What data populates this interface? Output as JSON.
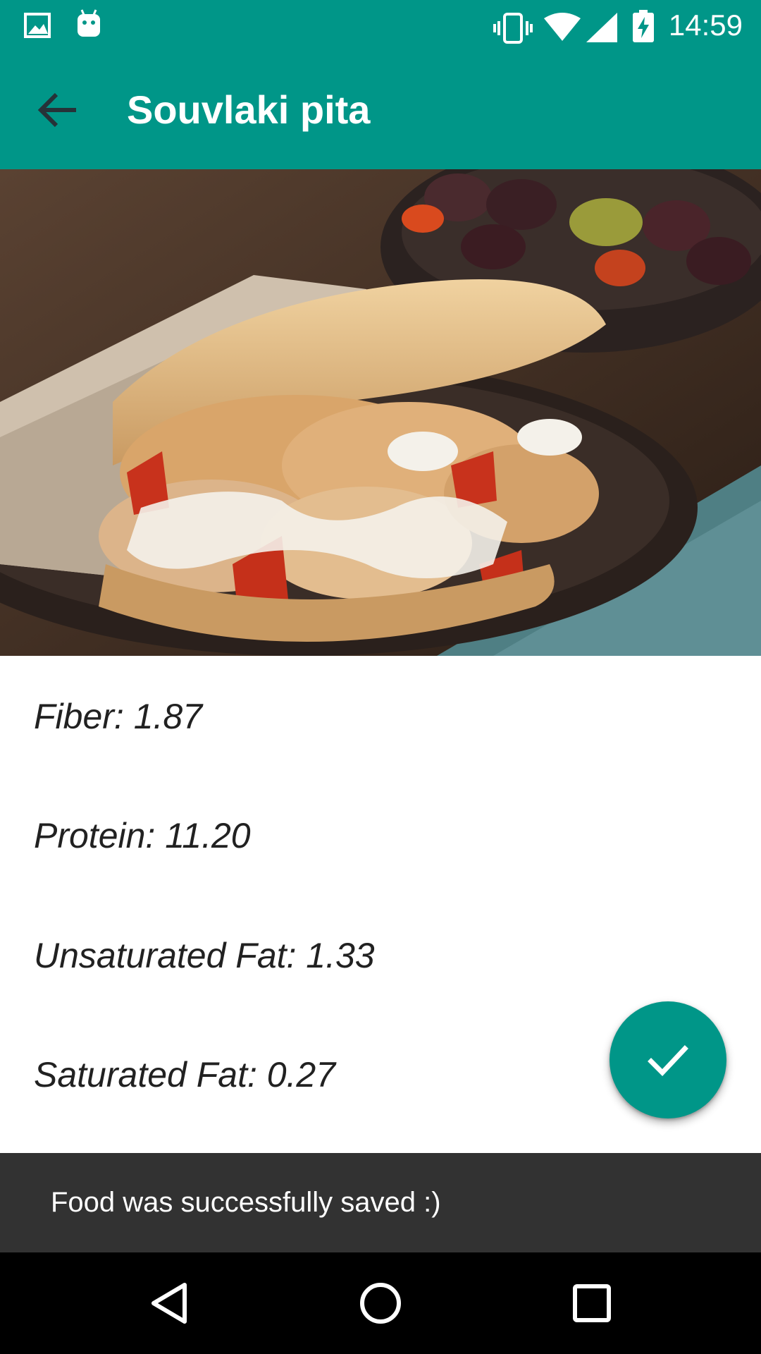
{
  "status_bar": {
    "time": "14:59",
    "left_icons": [
      "image-icon",
      "android-icon"
    ],
    "right_icons": [
      "vibrate-icon",
      "wifi-icon",
      "cell-signal-icon",
      "battery-charging-icon"
    ]
  },
  "app_bar": {
    "title": "Souvlaki pita",
    "back_icon": "arrow-back-icon",
    "color": "#009688"
  },
  "hero_image": {
    "subject": "souvlaki-pita-photo"
  },
  "nutrients": [
    {
      "text": "Fiber: 1.87"
    },
    {
      "text": "Protein: 11.20"
    },
    {
      "text": "Unsaturated Fat: 1.33"
    },
    {
      "text": "Saturated Fat: 0.27"
    }
  ],
  "fab": {
    "icon": "check-icon",
    "color": "#009688"
  },
  "snackbar": {
    "message": "Food was successfully saved :)"
  },
  "nav_bar": {
    "buttons": [
      "back-triangle-icon",
      "home-circle-icon",
      "recents-square-icon"
    ]
  }
}
